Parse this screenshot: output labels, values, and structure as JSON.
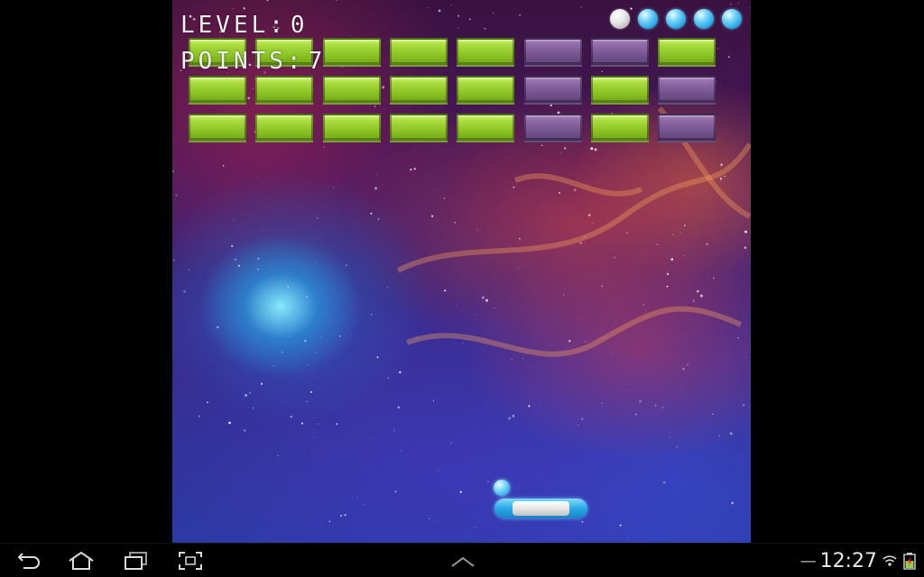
{
  "hud": {
    "level_label": "LEVEL:",
    "level_value": "0",
    "points_label": "POINTS:",
    "points_value": "7"
  },
  "lives": {
    "total": 5,
    "used": 1
  },
  "bricks": {
    "rows": [
      [
        "green",
        "green",
        "green",
        "green",
        "green",
        "purple",
        "purple",
        "green"
      ],
      [
        "green",
        "green",
        "green",
        "green",
        "green",
        "purple",
        "green",
        "purple"
      ],
      [
        "green",
        "green",
        "green",
        "green",
        "green",
        "purple",
        "green",
        "purple"
      ]
    ]
  },
  "colors": {
    "green_brick": "#9ad02e",
    "purple_brick": "#7c5a97",
    "ball": "#4fc0ee",
    "paddle": "#29a8e6",
    "hud_text": "#f2f2f2"
  },
  "status_bar": {
    "time": "12:27",
    "icons": [
      "back-icon",
      "home-icon",
      "recent-apps-icon",
      "screenshot-icon",
      "up-chevron-icon",
      "wifi-icon",
      "battery-icon"
    ]
  }
}
